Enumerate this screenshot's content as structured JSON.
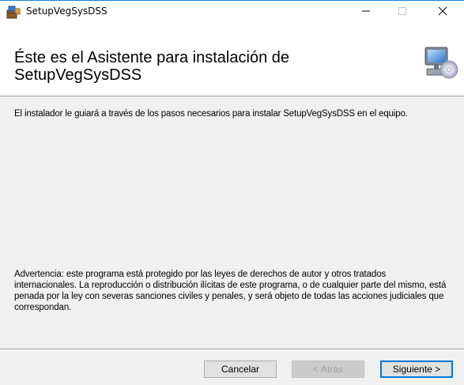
{
  "window": {
    "title": "SetupVegSysDSS",
    "icon": "installer-box-icon",
    "controls": {
      "minimize": "—",
      "maximize": "☐",
      "close": "✕"
    }
  },
  "header": {
    "title": "Éste es el Asistente para instalación de SetupVegSysDSS",
    "art_icon": "computer-cd-icon"
  },
  "body": {
    "intro": "El instalador le guiará a través de los pasos necesarios para instalar SetupVegSysDSS en el equipo.",
    "warning": "Advertencia: este programa está protegido por las leyes de derechos de autor y otros tratados internacionales. La reproducción o distribución ilícitas de este programa, o de cualquier parte del mismo, está penada por la ley con severas sanciones civiles y penales, y será objeto de todas las acciones judiciales que correspondan."
  },
  "buttons": {
    "cancel": "Cancelar",
    "back": "< Atrás",
    "next": "Siguiente >"
  },
  "colors": {
    "accent": "#0078d7",
    "dialog_bg": "#f0f0f0",
    "header_bg": "#ffffff",
    "disabled_text": "#a3a3a3"
  }
}
